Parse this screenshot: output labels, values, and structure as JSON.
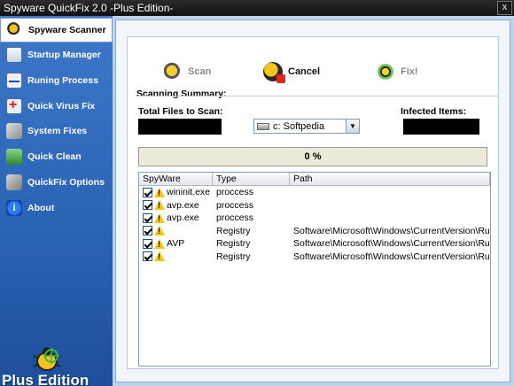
{
  "window": {
    "title": "Spyware QuickFix 2.0 -Plus Edition-",
    "close_label": "x"
  },
  "sidebar": {
    "items": [
      {
        "label": "Spyware Scanner",
        "icon": "bug-scanner-icon",
        "active": true
      },
      {
        "label": "Startup Manager",
        "icon": "startup-window-icon"
      },
      {
        "label": "Runing Process",
        "icon": "process-monitor-icon"
      },
      {
        "label": "Quick Virus Fix",
        "icon": "virus-cross-icon"
      },
      {
        "label": "System Fixes",
        "icon": "tools-icon"
      },
      {
        "label": "Quick Clean",
        "icon": "recycle-bin-icon"
      },
      {
        "label": "QuickFix Options",
        "icon": "wrench-icon"
      },
      {
        "label": "About",
        "icon": "info-icon"
      }
    ],
    "footer_label": "Plus Edition"
  },
  "toolbar": {
    "scan_label": "Scan",
    "cancel_label": "Cancel",
    "fix_label": "Fix!"
  },
  "summary": {
    "title": "Scanning Summary:",
    "total_label": "Total Files to Scan:",
    "infected_label": "Infected Items:",
    "drive": "c: Softpedia",
    "total_value": "",
    "infected_value": ""
  },
  "progress": {
    "value": 0,
    "label": "0 %"
  },
  "table": {
    "columns": [
      "SpyWare",
      "Type",
      "Path"
    ],
    "rows": [
      {
        "name": "wininit.exe",
        "type": "proccess",
        "path": ""
      },
      {
        "name": "avp.exe",
        "type": "proccess",
        "path": ""
      },
      {
        "name": "avp.exe",
        "type": "proccess",
        "path": ""
      },
      {
        "name": "",
        "type": "Registry",
        "path": "Software\\Microsoft\\Windows\\CurrentVersion\\Run"
      },
      {
        "name": "AVP",
        "type": "Registry",
        "path": "Software\\Microsoft\\Windows\\CurrentVersion\\Run"
      },
      {
        "name": "",
        "type": "Registry",
        "path": "Software\\Microsoft\\Windows\\CurrentVersion\\Run"
      }
    ]
  },
  "colors": {
    "sidebar": "#2a62b3",
    "background": "#b9d3f0",
    "warning": "#f3c615"
  }
}
